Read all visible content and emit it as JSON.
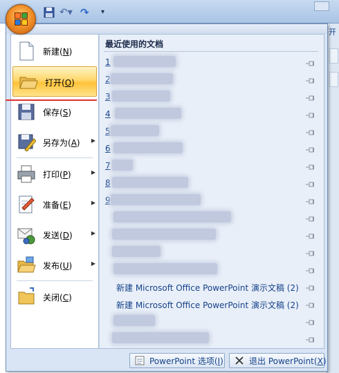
{
  "window": {
    "title_fragment": "开",
    "quick_access": [
      "save-icon",
      "undo-icon",
      "redo-icon",
      "customize-icon"
    ]
  },
  "office_button": {
    "icon": "office-logo-icon"
  },
  "menu": {
    "left_items": [
      {
        "label": "新建(",
        "key": "N",
        "suffix": ")",
        "icon": "new-document-icon",
        "has_arrow": false
      },
      {
        "label": "打开(",
        "key": "O",
        "suffix": ")",
        "icon": "open-folder-icon",
        "has_arrow": false
      },
      {
        "label": "保存(",
        "key": "S",
        "suffix": ")",
        "icon": "save-icon",
        "has_arrow": false
      },
      {
        "label": "另存为(",
        "key": "A",
        "suffix": ")",
        "icon": "save-as-icon",
        "has_arrow": true
      },
      {
        "label": "打印(",
        "key": "P",
        "suffix": ")",
        "icon": "print-icon",
        "has_arrow": true
      },
      {
        "label": "准备(",
        "key": "E",
        "suffix": ")",
        "icon": "prepare-icon",
        "has_arrow": true
      },
      {
        "label": "发送(",
        "key": "D",
        "suffix": ")",
        "icon": "send-icon",
        "has_arrow": true
      },
      {
        "label": "发布(",
        "key": "U",
        "suffix": ")",
        "icon": "publish-icon",
        "has_arrow": true
      },
      {
        "label": "关闭(",
        "key": "C",
        "suffix": ")",
        "icon": "close-folder-icon",
        "has_arrow": false
      }
    ],
    "recent": {
      "title": "最近使用的文档",
      "documents": [
        {
          "num": "1",
          "name": ""
        },
        {
          "num": "2",
          "name": ""
        },
        {
          "num": "3",
          "name": ""
        },
        {
          "num": "4",
          "name": ""
        },
        {
          "num": "5",
          "name": ""
        },
        {
          "num": "6",
          "name": ""
        },
        {
          "num": "7",
          "name": ""
        },
        {
          "num": "8",
          "name": ""
        },
        {
          "num": "9",
          "name": ""
        },
        {
          "num": "",
          "name": ""
        },
        {
          "num": "",
          "name": ""
        },
        {
          "num": "",
          "name": ""
        },
        {
          "num": "",
          "name": ""
        },
        {
          "num": "",
          "name": "新建 Microsoft Office PowerPoint 演示文稿 (2)"
        },
        {
          "num": "",
          "name": "新建 Microsoft Office PowerPoint 演示文稿 (2)"
        },
        {
          "num": "",
          "name": ""
        },
        {
          "num": "",
          "name": ""
        }
      ]
    },
    "bottom_buttons": {
      "options_label": "PowerPoint 选项(",
      "options_key": "I",
      "options_suffix": ")",
      "exit_label": "退出 PowerPoint(",
      "exit_key": "X",
      "exit_suffix": ")"
    }
  },
  "colors": {
    "accent": "#15428b",
    "highlight": "#ffd76a",
    "annotation_line": "#e03030"
  }
}
